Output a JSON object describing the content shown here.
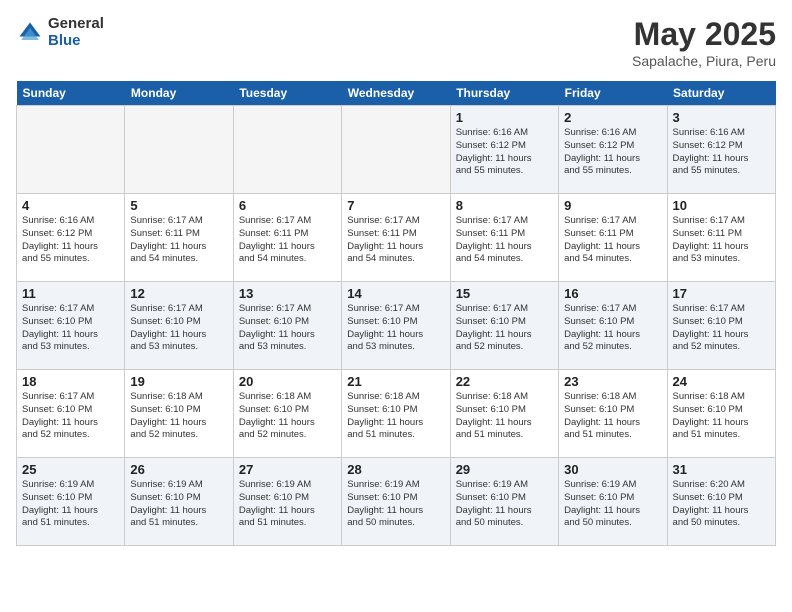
{
  "header": {
    "logo_general": "General",
    "logo_blue": "Blue",
    "month_title": "May 2025",
    "subtitle": "Sapalache, Piura, Peru"
  },
  "days_of_week": [
    "Sunday",
    "Monday",
    "Tuesday",
    "Wednesday",
    "Thursday",
    "Friday",
    "Saturday"
  ],
  "weeks": [
    [
      {
        "day": "",
        "empty": true
      },
      {
        "day": "",
        "empty": true
      },
      {
        "day": "",
        "empty": true
      },
      {
        "day": "",
        "empty": true
      },
      {
        "day": "1",
        "lines": [
          "Sunrise: 6:16 AM",
          "Sunset: 6:12 PM",
          "Daylight: 11 hours",
          "and 55 minutes."
        ]
      },
      {
        "day": "2",
        "lines": [
          "Sunrise: 6:16 AM",
          "Sunset: 6:12 PM",
          "Daylight: 11 hours",
          "and 55 minutes."
        ]
      },
      {
        "day": "3",
        "lines": [
          "Sunrise: 6:16 AM",
          "Sunset: 6:12 PM",
          "Daylight: 11 hours",
          "and 55 minutes."
        ]
      }
    ],
    [
      {
        "day": "4",
        "lines": [
          "Sunrise: 6:16 AM",
          "Sunset: 6:12 PM",
          "Daylight: 11 hours",
          "and 55 minutes."
        ]
      },
      {
        "day": "5",
        "lines": [
          "Sunrise: 6:17 AM",
          "Sunset: 6:11 PM",
          "Daylight: 11 hours",
          "and 54 minutes."
        ]
      },
      {
        "day": "6",
        "lines": [
          "Sunrise: 6:17 AM",
          "Sunset: 6:11 PM",
          "Daylight: 11 hours",
          "and 54 minutes."
        ]
      },
      {
        "day": "7",
        "lines": [
          "Sunrise: 6:17 AM",
          "Sunset: 6:11 PM",
          "Daylight: 11 hours",
          "and 54 minutes."
        ]
      },
      {
        "day": "8",
        "lines": [
          "Sunrise: 6:17 AM",
          "Sunset: 6:11 PM",
          "Daylight: 11 hours",
          "and 54 minutes."
        ]
      },
      {
        "day": "9",
        "lines": [
          "Sunrise: 6:17 AM",
          "Sunset: 6:11 PM",
          "Daylight: 11 hours",
          "and 54 minutes."
        ]
      },
      {
        "day": "10",
        "lines": [
          "Sunrise: 6:17 AM",
          "Sunset: 6:11 PM",
          "Daylight: 11 hours",
          "and 53 minutes."
        ]
      }
    ],
    [
      {
        "day": "11",
        "lines": [
          "Sunrise: 6:17 AM",
          "Sunset: 6:10 PM",
          "Daylight: 11 hours",
          "and 53 minutes."
        ]
      },
      {
        "day": "12",
        "lines": [
          "Sunrise: 6:17 AM",
          "Sunset: 6:10 PM",
          "Daylight: 11 hours",
          "and 53 minutes."
        ]
      },
      {
        "day": "13",
        "lines": [
          "Sunrise: 6:17 AM",
          "Sunset: 6:10 PM",
          "Daylight: 11 hours",
          "and 53 minutes."
        ]
      },
      {
        "day": "14",
        "lines": [
          "Sunrise: 6:17 AM",
          "Sunset: 6:10 PM",
          "Daylight: 11 hours",
          "and 53 minutes."
        ]
      },
      {
        "day": "15",
        "lines": [
          "Sunrise: 6:17 AM",
          "Sunset: 6:10 PM",
          "Daylight: 11 hours",
          "and 52 minutes."
        ]
      },
      {
        "day": "16",
        "lines": [
          "Sunrise: 6:17 AM",
          "Sunset: 6:10 PM",
          "Daylight: 11 hours",
          "and 52 minutes."
        ]
      },
      {
        "day": "17",
        "lines": [
          "Sunrise: 6:17 AM",
          "Sunset: 6:10 PM",
          "Daylight: 11 hours",
          "and 52 minutes."
        ]
      }
    ],
    [
      {
        "day": "18",
        "lines": [
          "Sunrise: 6:17 AM",
          "Sunset: 6:10 PM",
          "Daylight: 11 hours",
          "and 52 minutes."
        ]
      },
      {
        "day": "19",
        "lines": [
          "Sunrise: 6:18 AM",
          "Sunset: 6:10 PM",
          "Daylight: 11 hours",
          "and 52 minutes."
        ]
      },
      {
        "day": "20",
        "lines": [
          "Sunrise: 6:18 AM",
          "Sunset: 6:10 PM",
          "Daylight: 11 hours",
          "and 52 minutes."
        ]
      },
      {
        "day": "21",
        "lines": [
          "Sunrise: 6:18 AM",
          "Sunset: 6:10 PM",
          "Daylight: 11 hours",
          "and 51 minutes."
        ]
      },
      {
        "day": "22",
        "lines": [
          "Sunrise: 6:18 AM",
          "Sunset: 6:10 PM",
          "Daylight: 11 hours",
          "and 51 minutes."
        ]
      },
      {
        "day": "23",
        "lines": [
          "Sunrise: 6:18 AM",
          "Sunset: 6:10 PM",
          "Daylight: 11 hours",
          "and 51 minutes."
        ]
      },
      {
        "day": "24",
        "lines": [
          "Sunrise: 6:18 AM",
          "Sunset: 6:10 PM",
          "Daylight: 11 hours",
          "and 51 minutes."
        ]
      }
    ],
    [
      {
        "day": "25",
        "lines": [
          "Sunrise: 6:19 AM",
          "Sunset: 6:10 PM",
          "Daylight: 11 hours",
          "and 51 minutes."
        ]
      },
      {
        "day": "26",
        "lines": [
          "Sunrise: 6:19 AM",
          "Sunset: 6:10 PM",
          "Daylight: 11 hours",
          "and 51 minutes."
        ]
      },
      {
        "day": "27",
        "lines": [
          "Sunrise: 6:19 AM",
          "Sunset: 6:10 PM",
          "Daylight: 11 hours",
          "and 51 minutes."
        ]
      },
      {
        "day": "28",
        "lines": [
          "Sunrise: 6:19 AM",
          "Sunset: 6:10 PM",
          "Daylight: 11 hours",
          "and 50 minutes."
        ]
      },
      {
        "day": "29",
        "lines": [
          "Sunrise: 6:19 AM",
          "Sunset: 6:10 PM",
          "Daylight: 11 hours",
          "and 50 minutes."
        ]
      },
      {
        "day": "30",
        "lines": [
          "Sunrise: 6:19 AM",
          "Sunset: 6:10 PM",
          "Daylight: 11 hours",
          "and 50 minutes."
        ]
      },
      {
        "day": "31",
        "lines": [
          "Sunrise: 6:20 AM",
          "Sunset: 6:10 PM",
          "Daylight: 11 hours",
          "and 50 minutes."
        ]
      }
    ]
  ]
}
